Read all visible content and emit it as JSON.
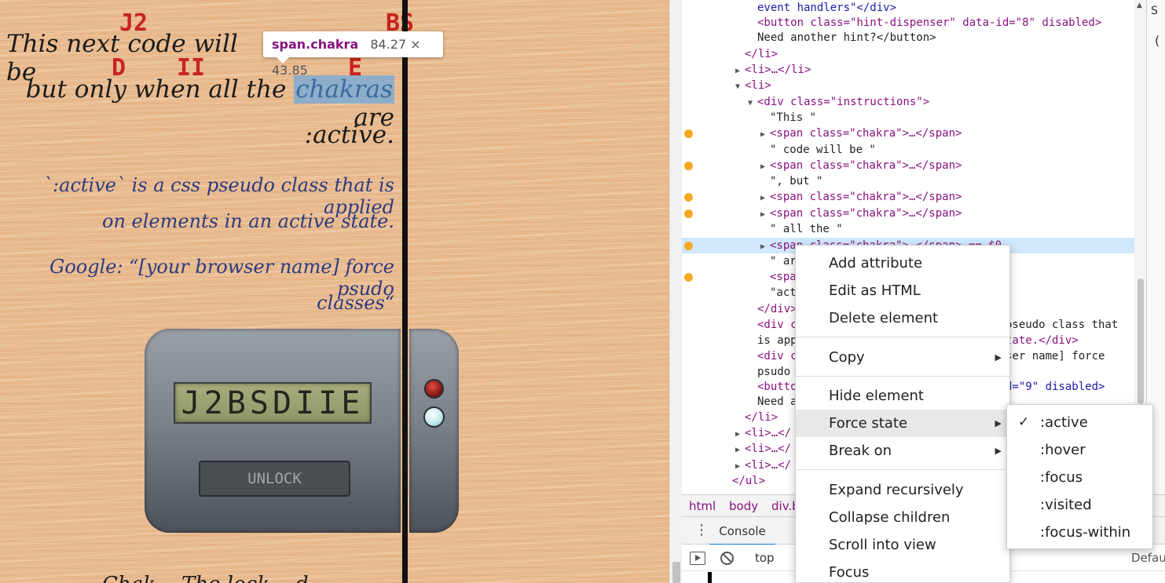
{
  "page": {
    "labels": {
      "j2": "J2",
      "bs": "BS",
      "d": "D",
      "ii": "II",
      "e": "E"
    },
    "line1": "This next code will be",
    "line2_pre": "but only when all the",
    "chakra_word": "chakras",
    "line2_post": "are",
    "line3": ":active.",
    "note1_a": "`:active` is a css pseudo class that is applied",
    "note1_b": "on elements in an active state.",
    "note2_a": "Google: “[your browser name] force psudo",
    "note2_b": "classes“",
    "bottom_partial": "Chak... The lock... d",
    "tooltip": {
      "tag": "span.chakra",
      "size": "84.27 × 43.85"
    },
    "lock": {
      "display": "J2BSDIIE",
      "unlock_label": "UNLOCK"
    }
  },
  "devtools": {
    "side_label": "S",
    "side_label2": "(",
    "dom_lines": [
      {
        "text": "event handlers\"</div>"
      },
      {
        "text": "<button class=\"hint-dispenser\" data-id=\"8\" disabled>"
      },
      {
        "text": "Need another hint?</button>"
      },
      {
        "text": "</li>"
      },
      {
        "text": "<li>…</li>"
      },
      {
        "text": "<li>"
      },
      {
        "text": "<div class=\"instructions\">"
      },
      {
        "text": "\"This \""
      },
      {
        "text": "<span class=\"chakra\">…</span>"
      },
      {
        "text": "\" code will be \""
      },
      {
        "text": "<span class=\"chakra\">…</span>"
      },
      {
        "text": "\", but \""
      },
      {
        "text": "<span class=\"chakra\">…</span>"
      },
      {
        "text": "<span class=\"chakra\">…</span>"
      },
      {
        "text": "\" all the \""
      },
      {
        "text": "<span class=\"chakra\">…</span> == $0"
      },
      {
        "text": "\" ar"
      },
      {
        "text": "<spa"
      },
      {
        "text": "\"act"
      },
      {
        "text": "</div>"
      },
      {
        "text": "<div c"
      },
      {
        "text": "is app"
      },
      {
        "text": "<div c"
      },
      {
        "text": "psudo"
      },
      {
        "text": "<butto"
      },
      {
        "text": "Need a"
      },
      {
        "text": "</li>"
      },
      {
        "text": "<li>…</"
      },
      {
        "text": "<li>…</"
      },
      {
        "text": "<li>…</"
      },
      {
        "text": "</ul>"
      }
    ],
    "dom_tail_fragments": {
      "pseudo_class": "pseudo class that",
      "state": "tate.</div>",
      "ser_name": "ser name] force",
      "data_id_9": "d=\"9\" disabled>"
    },
    "breadcrumb": [
      "html",
      "body",
      "div.b"
    ],
    "console_tab": "Console",
    "context": "top",
    "default_levels": "Defau"
  },
  "context_menu": {
    "items": [
      "Add attribute",
      "Edit as HTML",
      "Delete element",
      "Copy",
      "Hide element",
      "Force state",
      "Break on",
      "Expand recursively",
      "Collapse children",
      "Scroll into view",
      "Focus"
    ],
    "submenu_arrow": "▶"
  },
  "force_state_menu": {
    "items": [
      ":active",
      ":hover",
      ":focus",
      ":visited",
      ":focus-within"
    ],
    "checked": ":active",
    "check_mark": "✓"
  },
  "colors": {
    "tag": "#881280",
    "attr_name": "#994500",
    "attr_value": "#1a1aa6",
    "breakpoint": "#f6a821",
    "red_label": "#c8241f"
  }
}
